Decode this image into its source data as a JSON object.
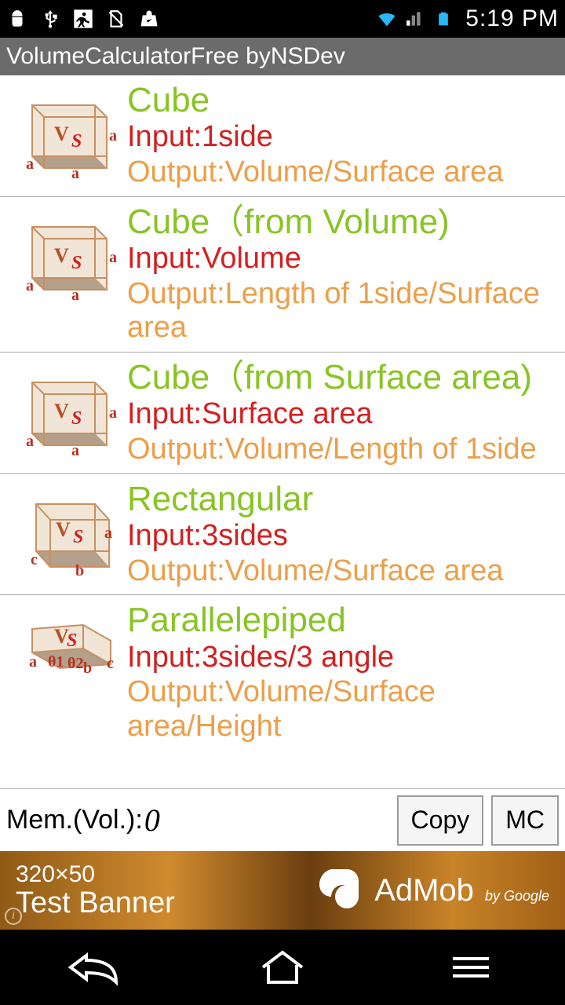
{
  "status": {
    "time": "5:19 PM"
  },
  "app": {
    "title": "VolumeCalculatorFree byNSDev"
  },
  "items": [
    {
      "title": "Cube",
      "input": "Input:1side",
      "output": "Output:Volume/Surface area"
    },
    {
      "title": "Cube（from Volume)",
      "input": "Input:Volume",
      "output": "Output:Length of 1side/Surface area"
    },
    {
      "title": "Cube（from Surface area)",
      "input": "Input:Surface area",
      "output": "Output:Volume/Length of 1side"
    },
    {
      "title": "Rectangular",
      "input": "Input:3sides",
      "output": "Output:Volume/Surface area"
    },
    {
      "title": "Parallelepiped",
      "input": "Input:3sides/3 angle",
      "output": "Output:Volume/Surface area/Height"
    }
  ],
  "memory": {
    "label": "Mem.(Vol.):",
    "value": "0",
    "copy": "Copy",
    "mc": "MC"
  },
  "ad": {
    "dim": "320×50",
    "test": "Test Banner",
    "brand": "AdMob",
    "by": "by Google"
  }
}
